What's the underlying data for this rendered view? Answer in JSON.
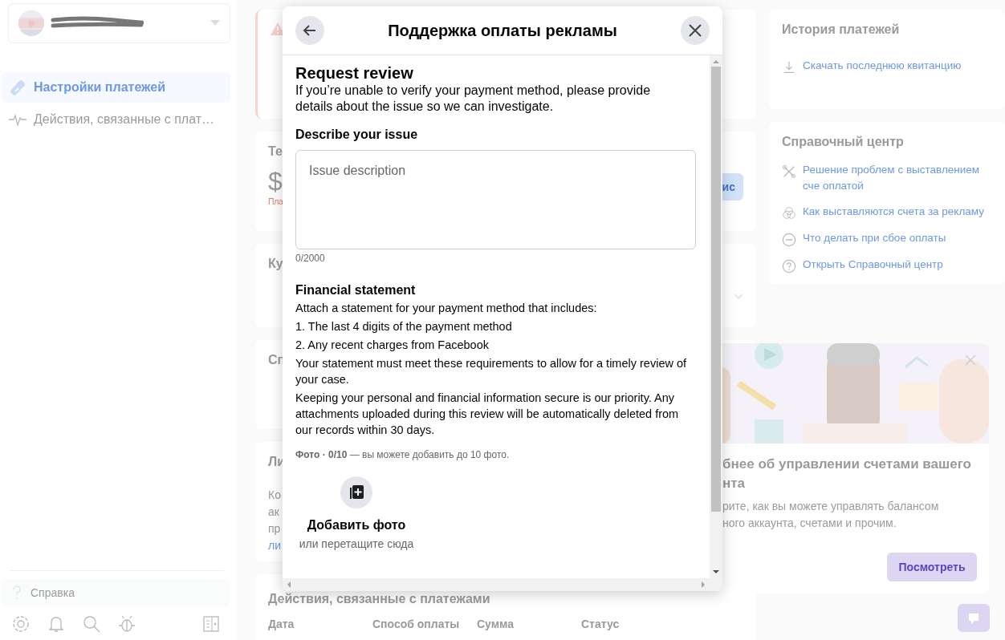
{
  "sidebar": {
    "nav_items": [
      {
        "label": "Настройки платежей",
        "selected": true
      },
      {
        "label": "Действия, связанные с плат…",
        "selected": false
      }
    ],
    "help_item": "Справка"
  },
  "main_cards": [
    {
      "kind": "alert"
    },
    {
      "kind": "balance",
      "title": "Те",
      "amount": "$",
      "note": "Пла",
      "button": "ис"
    },
    {
      "kind": "coupons",
      "title": "Ку"
    },
    {
      "kind": "methods",
      "title": "Сп"
    },
    {
      "kind": "limit",
      "title": "Ли",
      "lines": [
        "Ко",
        "ак",
        "пр"
      ],
      "link": "ли"
    },
    {
      "kind": "activity",
      "title": "Действия, связанные с платежами",
      "columns": [
        "Дата",
        "Способ оплаты",
        "Сумма",
        "Статус"
      ]
    }
  ],
  "history": {
    "title": "История платежей",
    "link": "Скачать последнюю квитанцию"
  },
  "help_center": {
    "title": "Справочный центр",
    "links": [
      "Решение проблем с выставлением сче оплатой",
      "Как выставляются счета за рекламу",
      "Что делать при сбое оплаты",
      "Открыть Справочный центр"
    ]
  },
  "promo": {
    "title": "бнее об управлении счетами вашего нта",
    "description": "рите, как вы можете управлять балансом ного аккаунта, счетами и прочим.",
    "button": "Посмотреть"
  },
  "dialog": {
    "title": "Поддержка оплаты рекламы",
    "heading": "Request review",
    "intro": "If you’re unable to verify your payment method, please provide details about the issue so we can investigate.",
    "issue_label": "Describe your issue",
    "issue_field": {
      "placeholder": "Issue description"
    },
    "counter": "0/2000",
    "statement_title": "Financial statement",
    "statement_paragraphs": [
      "Attach a statement for your payment method that includes:",
      "1. The last 4 digits of the payment method",
      "2. Any recent charges from Facebook",
      "Your statement must meet these requirements to allow for a timely review of your case.",
      "Keeping your personal and financial information secure is our priority. Any attachments uploaded during this review will be automatically deleted from our records within 30 days."
    ],
    "photo_note": "**Фото · 0/10** — вы можете добавить до 10 фото.",
    "add_photo": {
      "label": "Добавить фото",
      "hint": "или перетащите сюда"
    }
  }
}
